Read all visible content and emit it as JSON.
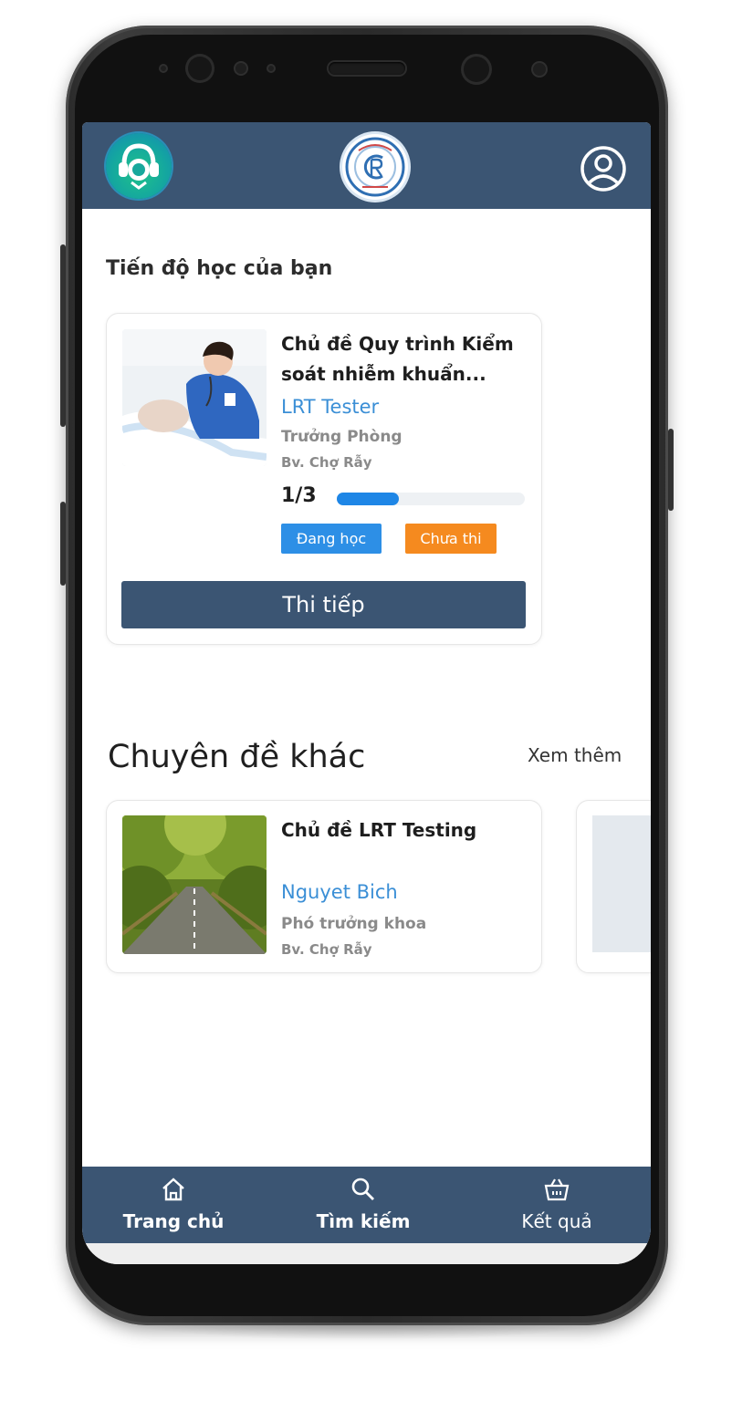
{
  "header": {
    "left_logo_icon": "app-logo-icon",
    "center_logo_icon": "hospital-emblem-icon",
    "profile_icon": "user-circle-icon"
  },
  "progress_section": {
    "title": "Tiến độ học của bạn",
    "course": {
      "title_line1": "Chủ đề Quy trình Kiểm",
      "title_line2": "soát nhiễm khuẩn...",
      "author": "LRT Tester",
      "role": "Trưởng Phòng",
      "hospital": "Bv. Chợ Rẫy",
      "progress_text": "1/3",
      "progress_fraction": 0.33,
      "status_badge": "Đang học",
      "exam_badge": "Chưa thi",
      "continue_button": "Thi tiếp"
    }
  },
  "other_section": {
    "title": "Chuyên đề khác",
    "see_more": "Xem thêm",
    "courses": [
      {
        "title": "Chủ đề LRT Testing",
        "author": "Nguyet Bich",
        "role": "Phó trưởng khoa",
        "hospital": "Bv. Chợ Rẫy"
      }
    ]
  },
  "bottom_nav": {
    "items": [
      {
        "label": "Trang chủ",
        "icon": "home-icon"
      },
      {
        "label": "Tìm kiếm",
        "icon": "search-icon"
      },
      {
        "label": "Kết quả",
        "icon": "results-basket-icon"
      }
    ]
  },
  "colors": {
    "primary": "#3b5573",
    "accent_blue": "#2d8fe6",
    "accent_orange": "#f58a1f",
    "link_blue": "#3b8fd6"
  }
}
